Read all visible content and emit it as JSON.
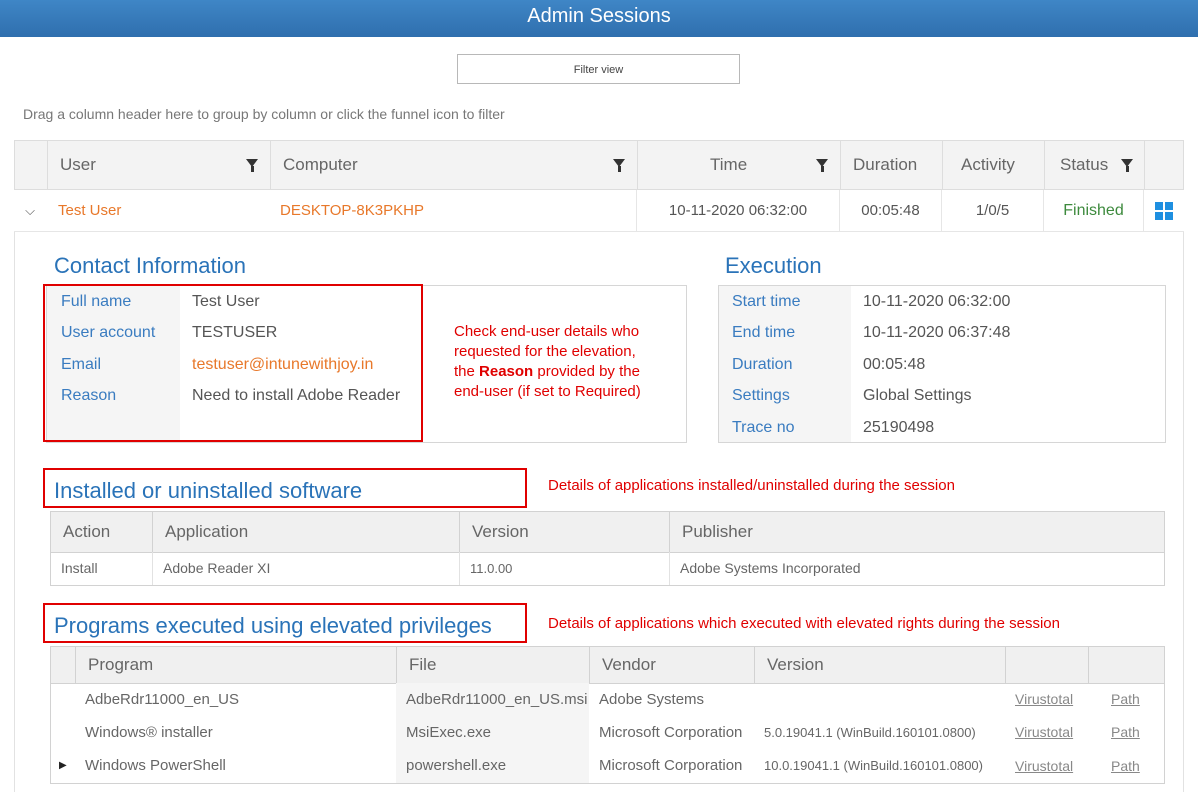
{
  "header": {
    "title": "Admin Sessions"
  },
  "toolbar": {
    "filter_label": "Filter view"
  },
  "hint": "Drag a column header here to group by column or click the funnel icon to filter",
  "grid": {
    "columns": [
      "User",
      "Computer",
      "Time",
      "Duration",
      "Activity",
      "Status"
    ],
    "row": {
      "user": "Test User",
      "computer": "DESKTOP-8K3PKHP",
      "time": "10-11-2020 06:32:00",
      "duration": "00:05:48",
      "activity": "1/0/5",
      "status": "Finished",
      "platform_icon": "windows-icon"
    }
  },
  "contact": {
    "title": "Contact Information",
    "fields": [
      {
        "label": "Full name",
        "value": "Test User"
      },
      {
        "label": "User account",
        "value": "TESTUSER"
      },
      {
        "label": "Email",
        "value": "testuser@intunewithjoy.in"
      },
      {
        "label": "Reason",
        "value": "Need to install Adobe Reader"
      }
    ]
  },
  "annotation_contact": {
    "line1": "Check end-user details who",
    "line2": "requested for the elevation,",
    "line3_pre": "the ",
    "line3_bold": "Reason",
    "line3_post": " provided by the",
    "line4": "end-user (if set to Required)"
  },
  "execution": {
    "title": "Execution",
    "fields": [
      {
        "label": "Start time",
        "value": "10-11-2020 06:32:00"
      },
      {
        "label": "End time",
        "value": "10-11-2020 06:37:48"
      },
      {
        "label": "Duration",
        "value": "00:05:48"
      },
      {
        "label": "Settings",
        "value": "Global Settings"
      },
      {
        "label": "Trace no",
        "value": "25190498"
      }
    ]
  },
  "software": {
    "title": "Installed or uninstalled software",
    "annotation": "Details of applications installed/uninstalled during the session",
    "columns": [
      "Action",
      "Application",
      "Version",
      "Publisher"
    ],
    "rows": [
      {
        "action": "Install",
        "application": "Adobe Reader XI",
        "version": "11.0.00",
        "publisher": "Adobe Systems Incorporated"
      }
    ]
  },
  "programs": {
    "title": "Programs executed using elevated privileges",
    "annotation": "Details of applications which executed with elevated rights during the session",
    "columns": [
      "Program",
      "File",
      "Vendor",
      "Version",
      "",
      ""
    ],
    "rows": [
      {
        "program": "AdbeRdr11000_en_US",
        "file": "AdbeRdr11000_en_US.msi",
        "vendor": "Adobe Systems",
        "version": "",
        "link1": "Virustotal",
        "link2": "Path"
      },
      {
        "program": "Windows® installer",
        "file": "MsiExec.exe",
        "vendor": "Microsoft Corporation",
        "version": "5.0.19041.1 (WinBuild.160101.0800)",
        "link1": "Virustotal",
        "link2": "Path"
      },
      {
        "program": "Windows PowerShell",
        "file": "powershell.exe",
        "vendor": "Microsoft Corporation",
        "version": "10.0.19041.1 (WinBuild.160101.0800)",
        "link1": "Virustotal",
        "link2": "Path"
      }
    ]
  },
  "colors": {
    "accent": "#2a73b8",
    "link_orange": "#e8782a",
    "status_green": "#3d8a3d",
    "annotation_red": "#e00000"
  }
}
